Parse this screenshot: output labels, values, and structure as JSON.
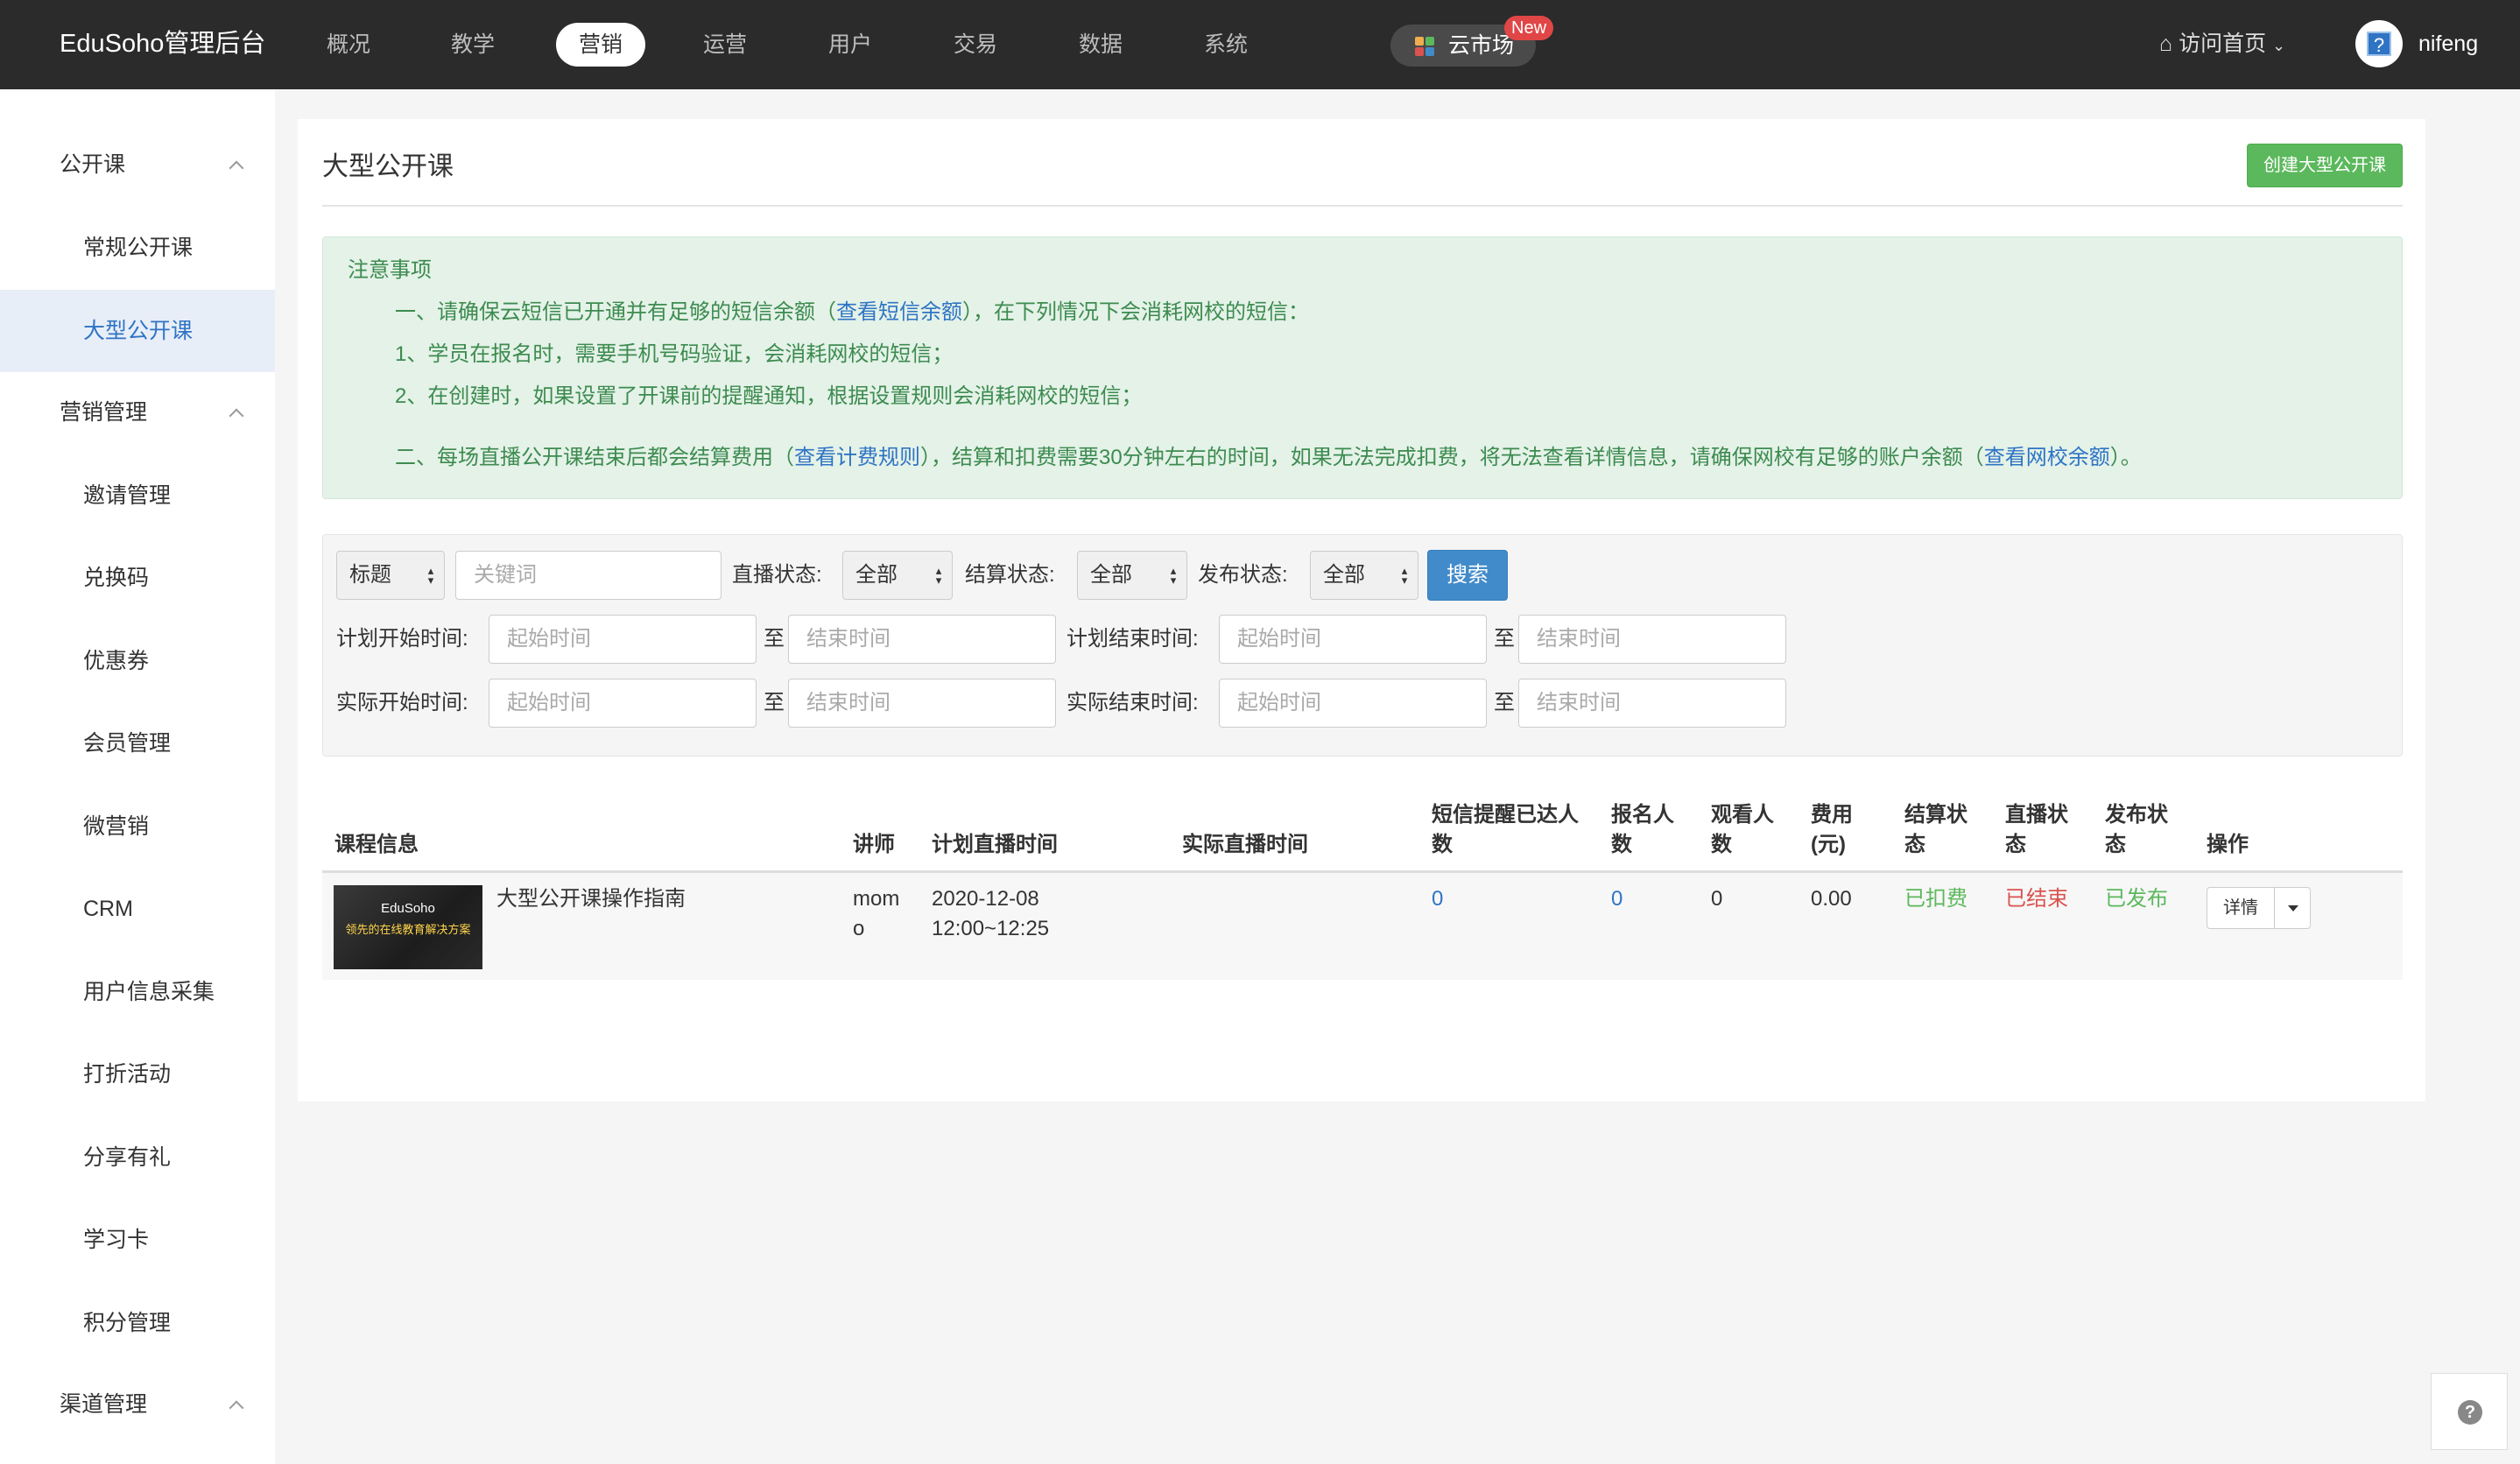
{
  "app": {
    "brand": "EduSoho管理后台"
  },
  "nav": {
    "items": [
      {
        "label": "概况"
      },
      {
        "label": "教学"
      },
      {
        "label": "营销"
      },
      {
        "label": "运营"
      },
      {
        "label": "用户"
      },
      {
        "label": "交易"
      },
      {
        "label": "数据"
      },
      {
        "label": "系统"
      }
    ],
    "active_index": 2,
    "cloud_market": "云市场",
    "new_badge": "New",
    "visit_home": "访问首页",
    "username": "nifeng"
  },
  "sidebar": {
    "groups": [
      {
        "label": "公开课"
      },
      {
        "label": "营销管理"
      },
      {
        "label": "渠道管理"
      }
    ],
    "items": [
      {
        "label": "常规公开课"
      },
      {
        "label": "大型公开课"
      },
      {
        "label": "邀请管理"
      },
      {
        "label": "兑换码"
      },
      {
        "label": "优惠券"
      },
      {
        "label": "会员管理"
      },
      {
        "label": "微营销"
      },
      {
        "label": "CRM"
      },
      {
        "label": "用户信息采集"
      },
      {
        "label": "打折活动"
      },
      {
        "label": "分享有礼"
      },
      {
        "label": "学习卡"
      },
      {
        "label": "积分管理"
      }
    ]
  },
  "page": {
    "title": "大型公开课",
    "create_button": "创建大型公开课"
  },
  "notice": {
    "heading": "注意事项",
    "line1_pre": "一、请确保云短信已开通并有足够的短信余额（",
    "line1_link": "查看短信余额",
    "line1_post": "），在下列情况下会消耗网校的短信：",
    "line2": "1、学员在报名时，需要手机号码验证，会消耗网校的短信；",
    "line3": "2、在创建时，如果设置了开课前的提醒通知，根据设置规则会消耗网校的短信；",
    "line4_pre": "二、每场直播公开课结束后都会结算费用（",
    "line4_link1": "查看计费规则",
    "line4_mid": "），结算和扣费需要30分钟左右的时间，如果无法完成扣费，将无法查看详情信息，请确保网校有足够的账户余额（",
    "line4_link2": "查看网校余额",
    "line4_post": "）。"
  },
  "filter": {
    "field_select": "标题",
    "keyword_placeholder": "关键词",
    "live_status_label": "直播状态:",
    "live_status_value": "全部",
    "settle_status_label": "结算状态:",
    "settle_status_value": "全部",
    "publish_status_label": "发布状态:",
    "publish_status_value": "全部",
    "search_button": "搜索",
    "plan_start_label": "计划开始时间:",
    "plan_end_label": "计划结束时间:",
    "actual_start_label": "实际开始时间:",
    "actual_end_label": "实际结束时间:",
    "start_placeholder": "起始时间",
    "end_placeholder": "结束时间",
    "to": "至"
  },
  "table": {
    "headers": {
      "course": "课程信息",
      "teacher": "讲师",
      "plan_time": "计划直播时间",
      "actual_time": "实际直播时间",
      "sms_l1": "短信提醒已达人",
      "sms_l2": "数",
      "enroll_l1": "报名人",
      "enroll_l2": "数",
      "viewers_l1": "观看人",
      "viewers_l2": "数",
      "fee_l1": "费用",
      "fee_l2": "(元)",
      "settle_l1": "结算状",
      "settle_l2": "态",
      "live_l1": "直播状",
      "live_l2": "态",
      "publish_l1": "发布状",
      "publish_l2": "态",
      "ops": "操作"
    },
    "rows": [
      {
        "title": "大型公开课操作指南",
        "thumb_brand": "EduSoho",
        "thumb_slogan": "领先的在线教育解决方案",
        "teacher_l1": "mom",
        "teacher_l2": "o",
        "plan_date": "2020-12-08",
        "plan_range": "12:00~12:25",
        "actual_time": "",
        "sms": "0",
        "enroll": "0",
        "viewers": "0",
        "fee": "0.00",
        "settle_status": "已扣费",
        "live_status": "已结束",
        "publish_status": "已发布",
        "detail_button": "详情"
      }
    ]
  },
  "help": "?"
}
